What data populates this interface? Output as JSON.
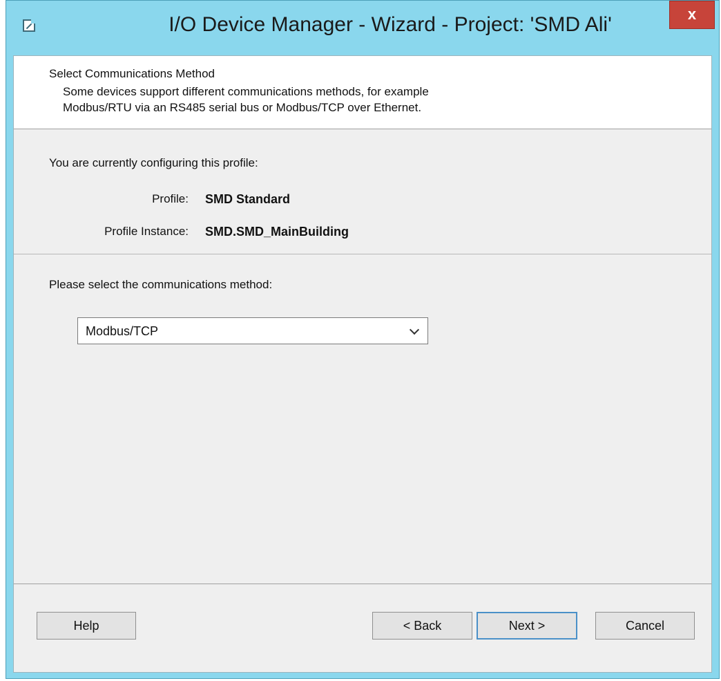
{
  "window": {
    "title": "I/O Device Manager - Wizard - Project: 'SMD Ali'",
    "close_label": "x"
  },
  "header": {
    "title": "Select Communications Method",
    "description_line1": "Some devices support different communications methods, for example",
    "description_line2": "Modbus/RTU via an RS485 serial bus or Modbus/TCP over Ethernet."
  },
  "profile": {
    "intro": "You are currently configuring this profile:",
    "profile_label": "Profile:",
    "profile_value": "SMD Standard",
    "instance_label": "Profile Instance:",
    "instance_value": "SMD.SMD_MainBuilding"
  },
  "method": {
    "prompt": "Please select the communications method:",
    "selected": "Modbus/TCP"
  },
  "buttons": {
    "help": "Help",
    "back": "< Back",
    "next": "Next >",
    "cancel": "Cancel"
  },
  "colors": {
    "title_bar": "#8ad7ed",
    "close_button": "#c7443a",
    "panel_background": "#efefef",
    "default_button_border": "#4a90c8"
  },
  "icons": {
    "app": "edit-window-icon",
    "close": "close-icon",
    "dropdown": "chevron-down-icon"
  }
}
